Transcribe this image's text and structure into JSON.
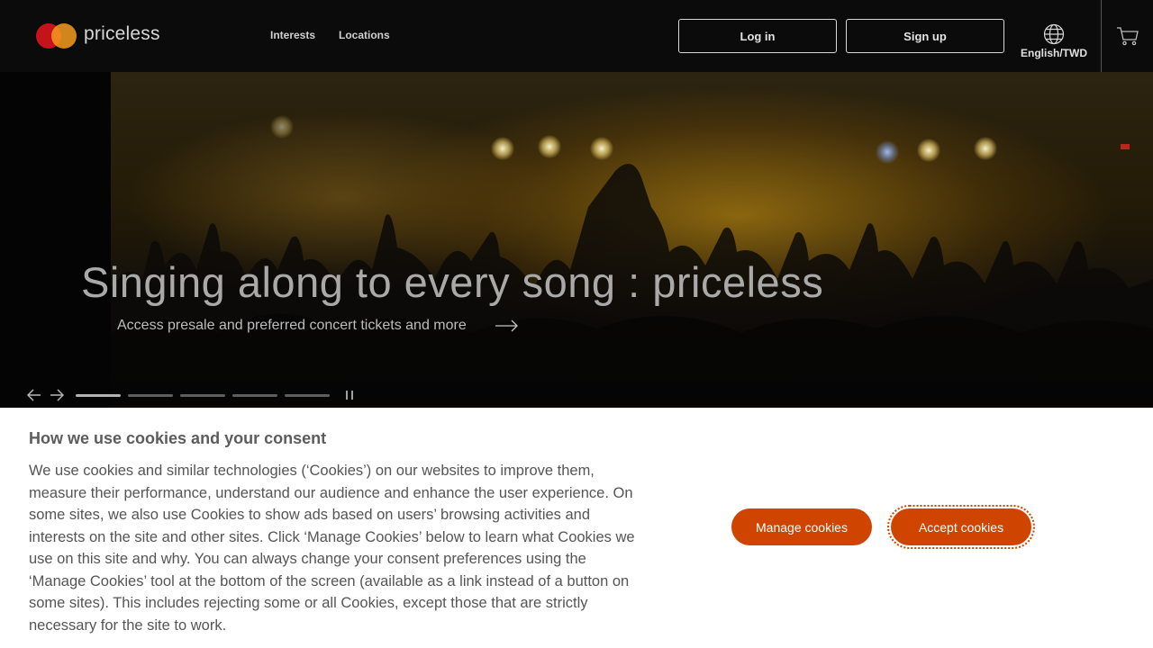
{
  "header": {
    "brand": "priceless",
    "nav": [
      {
        "label": "Interests"
      },
      {
        "label": "Locations"
      }
    ],
    "login_label": "Log in",
    "signup_label": "Sign up",
    "locale_label": "English/TWD",
    "icons": {
      "language": "globe-icon",
      "cart": "cart-icon"
    }
  },
  "hero": {
    "title": "Singing along to every song :  priceless",
    "subtitle": "Access presale and preferred concert tickets and more",
    "slides_count": 5,
    "active_slide": 1,
    "icons": {
      "prev": "arrow-left-icon",
      "next": "arrow-right-icon",
      "pause": "pause-icon",
      "cta": "arrow-right-icon"
    }
  },
  "cookie_banner": {
    "title": "How we use cookies and your consent",
    "body": "We use cookies and similar technologies (‘Cookies’) on our websites to improve them, measure their performance, understand our audience and enhance the user experience. On some sites, we also use Cookies to show ads based on users’ browsing activities and interests on the site and other sites. Click ‘Manage Cookies’ below to learn what Cookies we use on this site and why. You can always change your consent preferences using the ‘Manage Cookies’ tool at the bottom of the screen (available as a link instead of a button on some sites). This includes rejecting some or all Cookies, except those that are strictly necessary for the site to work.",
    "manage_label": "Manage cookies",
    "accept_label": "Accept cookies"
  },
  "colors": {
    "header_bg": "#0b0b0b",
    "accent": "#cf4500",
    "mastercard_red": "#c5131b",
    "mastercard_orange": "#f49b1d"
  }
}
